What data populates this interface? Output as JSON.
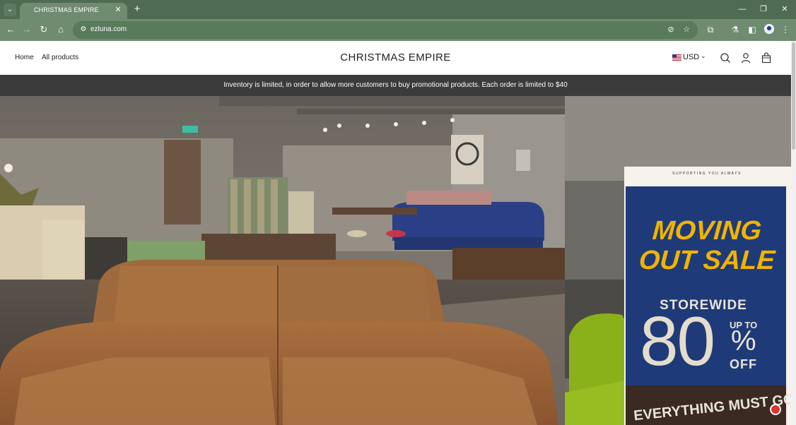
{
  "browser": {
    "tab_title": "CHRISTMAS EMPIRE",
    "url": "ezluna.com"
  },
  "header": {
    "nav": [
      "Home",
      "All products"
    ],
    "brand": "CHRISTMAS EMPIRE",
    "currency": "USD"
  },
  "announcement": "Inventory is limited, in order to allow more customers to buy promotional products. Each order is limited to $40",
  "hero": {
    "banner": {
      "tagline": "SUPPORTING YOU ALWAYS",
      "headline_line1": "MOVING",
      "headline_line2": "OUT SALE",
      "storewide": "STOREWIDE",
      "big_number": "80",
      "up_to": "UP TO",
      "percent": "%",
      "off": "OFF",
      "footer": "EVERYTHING MUST GO"
    }
  },
  "colors": {
    "tabbar": "#4f6b52",
    "toolbar": "#6f8b70",
    "announcement_bg": "#3b3b3b",
    "banner_blue": "#1f3a78",
    "banner_yellow": "#f0b400"
  }
}
